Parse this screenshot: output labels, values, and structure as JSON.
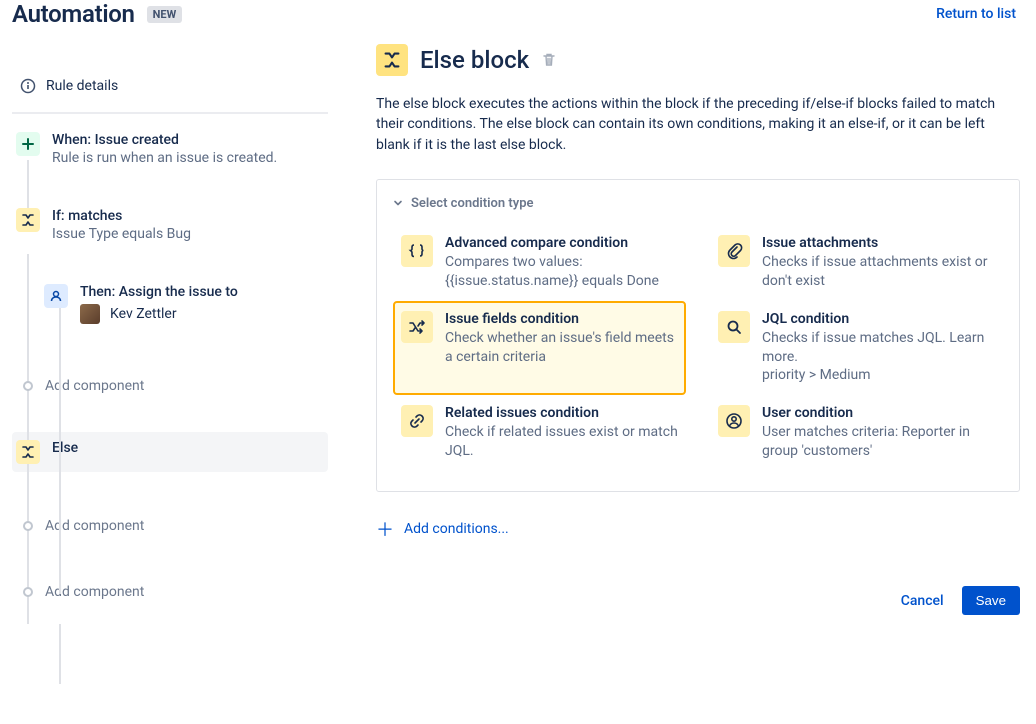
{
  "header": {
    "title": "Automation",
    "badge": "NEW",
    "return_link": "Return to list"
  },
  "rule_details": {
    "label": "Rule details"
  },
  "tree": {
    "when": {
      "title": "When: Issue created",
      "sub": "Rule is run when an issue is created."
    },
    "if": {
      "title": "If: matches",
      "sub": "Issue Type equals Bug"
    },
    "then": {
      "title": "Then: Assign the issue to",
      "assignee": "Kev Zettler"
    },
    "else": {
      "title": "Else"
    },
    "add_component": "Add component"
  },
  "main": {
    "title": "Else block",
    "description": "The else block executes the actions within the block if the preceding if/else-if blocks failed to match their conditions. The else block can contain its own conditions, making it an else-if, or it can be left blank if it is the last else block."
  },
  "panel": {
    "header": "Select condition type",
    "conditions": [
      {
        "title": "Advanced compare condition",
        "desc": "Compares two values: {{issue.status.name}} equals Done",
        "icon": "braces"
      },
      {
        "title": "Issue attachments",
        "desc": "Checks if issue attachments exist or don't exist",
        "icon": "attachment"
      },
      {
        "title": "Issue fields condition",
        "desc": "Check whether an issue's field meets a certain criteria",
        "icon": "shuffle",
        "selected": true
      },
      {
        "title": "JQL condition",
        "desc": "Checks if issue matches JQL. Learn more.\npriority > Medium",
        "icon": "search"
      },
      {
        "title": "Related issues condition",
        "desc": "Check if related issues exist or match JQL.",
        "icon": "link"
      },
      {
        "title": "User condition",
        "desc": "User matches criteria: Reporter in group 'customers'",
        "icon": "user"
      }
    ]
  },
  "add_conditions": "Add conditions...",
  "footer": {
    "cancel": "Cancel",
    "save": "Save"
  }
}
